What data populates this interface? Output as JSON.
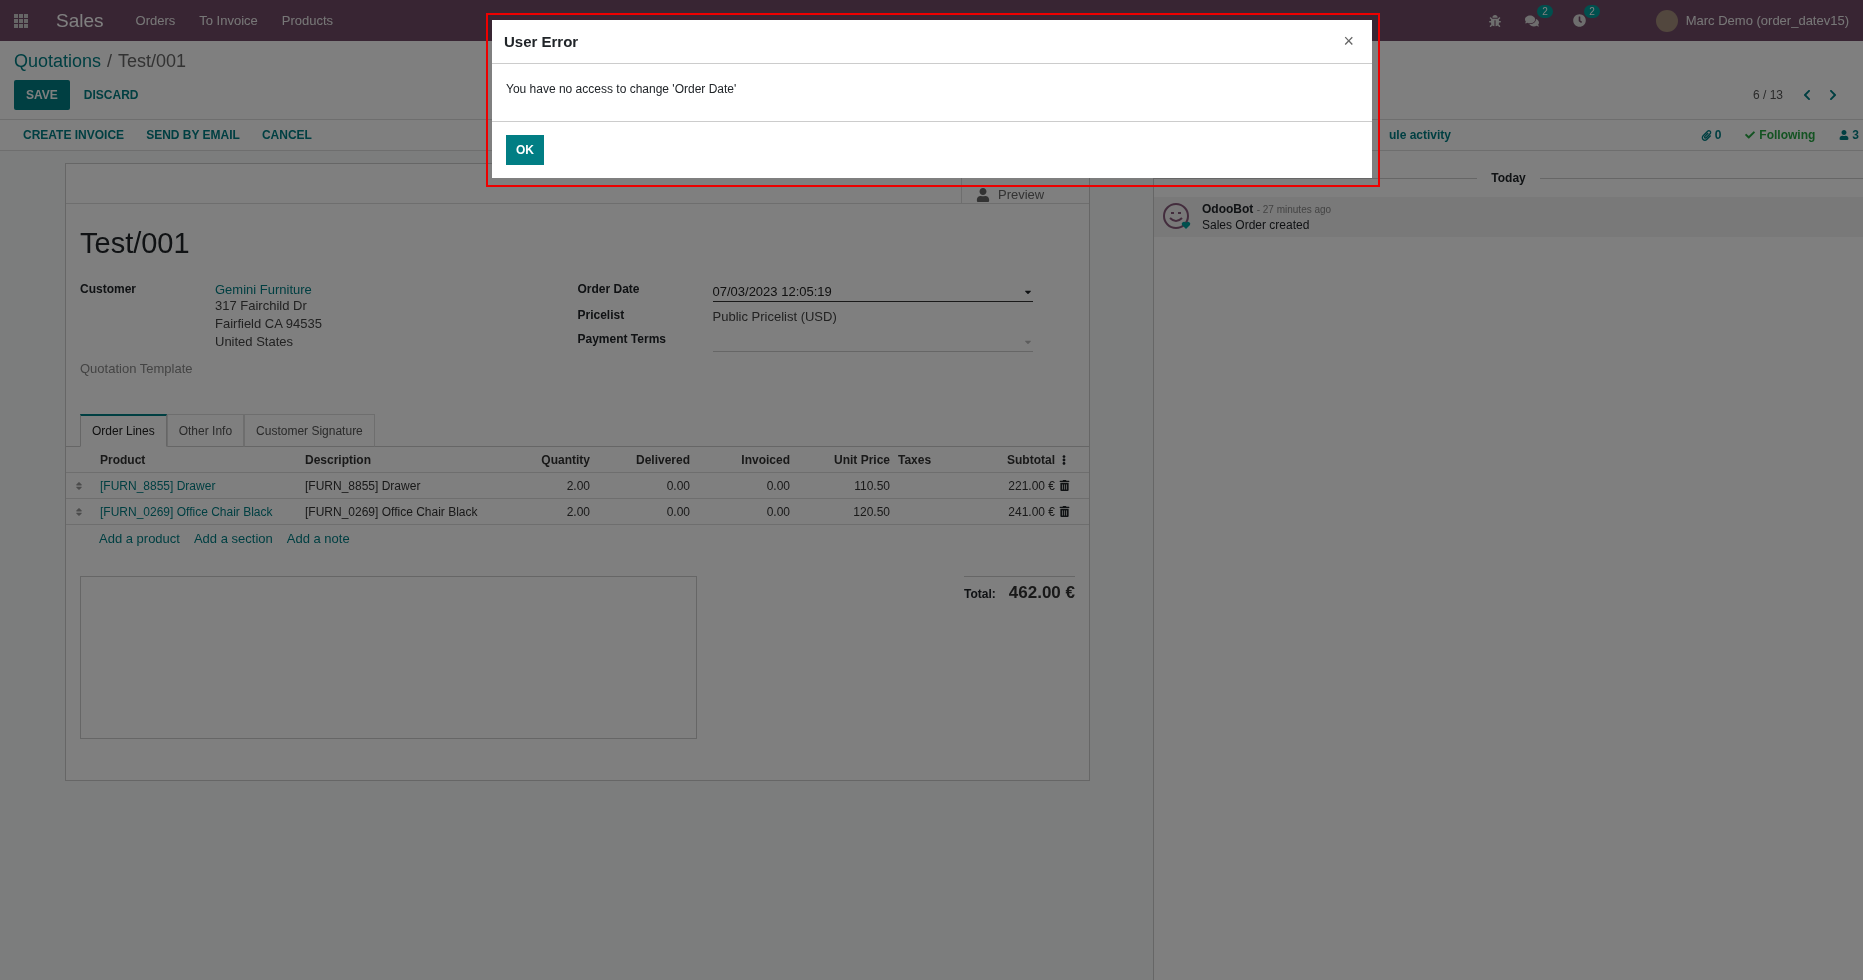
{
  "topbar": {
    "app": "Sales",
    "menu": [
      "Orders",
      "To Invoice",
      "Products"
    ],
    "messages_count": "2",
    "activities_count": "2",
    "user": "Marc Demo (order_datev15)"
  },
  "breadcrumb": {
    "parent": "Quotations",
    "separator": "/",
    "current": "Test/001"
  },
  "form_buttons": [
    "SAVE",
    "DISCARD"
  ],
  "pager": "6 / 13",
  "actions": [
    "CREATE INVOICE",
    "SEND BY EMAIL",
    "CANCEL"
  ],
  "stat_button": {
    "label": "Preview"
  },
  "record": {
    "title": "Test/001",
    "customer_label": "Customer",
    "customer": "Gemini Furniture",
    "address": [
      "317 Fairchild Dr",
      "Fairfield CA 94535",
      "United States"
    ],
    "template_label": "Quotation Template",
    "fields": [
      {
        "label": "Order Date",
        "value": "07/03/2023 12:05:19",
        "kind": "date"
      },
      {
        "label": "Pricelist",
        "value": "Public Pricelist (USD)",
        "kind": "text"
      },
      {
        "label": "Payment Terms",
        "kind": "select"
      }
    ]
  },
  "tabs": [
    {
      "label": "Order Lines",
      "selected": true
    },
    {
      "label": "Other Info",
      "selected": false
    },
    {
      "label": "Customer Signature",
      "selected": false
    }
  ],
  "table": {
    "columns": [
      "Product",
      "Description",
      "Quantity",
      "Delivered",
      "Invoiced",
      "Unit Price",
      "Taxes",
      "Subtotal"
    ],
    "rows": [
      {
        "product": "[FURN_8855] Drawer",
        "description": "[FURN_8855] Drawer",
        "quantity": "2.00",
        "delivered": "0.00",
        "invoiced": "0.00",
        "unit_price": "110.50",
        "subtotal": "221.00 €"
      },
      {
        "product": "[FURN_0269] Office Chair Black",
        "description": "[FURN_0269] Office Chair Black",
        "quantity": "2.00",
        "delivered": "0.00",
        "invoiced": "0.00",
        "unit_price": "120.50",
        "subtotal": "241.00 €"
      }
    ]
  },
  "add_links": [
    "Add a product",
    "Add a section",
    "Add a note"
  ],
  "total": {
    "label": "Total:",
    "value": "462.00 €"
  },
  "chatter": {
    "partial_action": "ule activity",
    "attachments": "0",
    "follow": "Following",
    "followers": "3",
    "date_separator": "Today",
    "messages": [
      {
        "author": "OdooBot",
        "time": "- 27 minutes ago",
        "body": "Sales Order created"
      }
    ]
  },
  "dialog": {
    "close": "×",
    "title": "User Error",
    "message": "You have no access to change 'Order Date'",
    "button": "OK"
  }
}
